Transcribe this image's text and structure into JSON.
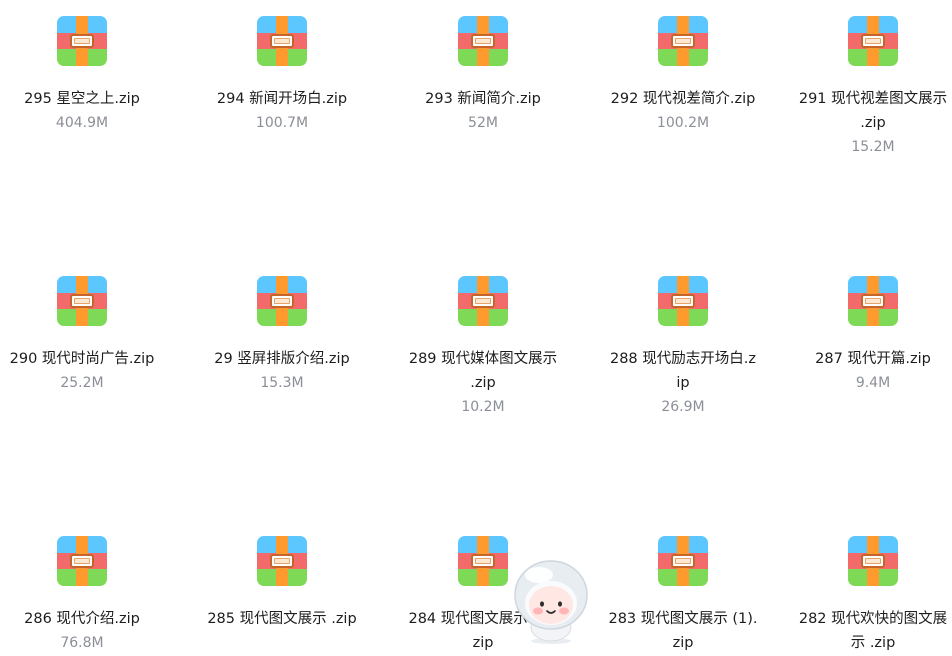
{
  "files": [
    {
      "name": "295 星空之上.zip",
      "size": "404.9M"
    },
    {
      "name": "294 新闻开场白.zip",
      "size": "100.7M"
    },
    {
      "name": "293 新闻简介.zip",
      "size": "52M"
    },
    {
      "name": "292 现代视差简介.zip",
      "size": "100.2M"
    },
    {
      "name": "291 现代视差图文展示 .zip",
      "size": "15.2M"
    },
    {
      "name": "290 现代时尚广告.zip",
      "size": "25.2M"
    },
    {
      "name": "29 竖屏排版介绍.zip",
      "size": "15.3M"
    },
    {
      "name": "289 现代媒体图文展示 .zip",
      "size": "10.2M"
    },
    {
      "name": "288 现代励志开场白.zip",
      "size": "26.9M"
    },
    {
      "name": "287 现代开篇.zip",
      "size": "9.4M"
    },
    {
      "name": "286 现代介绍.zip",
      "size": "76.8M"
    },
    {
      "name": "285 现代图文展示 .zip",
      "size": ""
    },
    {
      "name": "284 现代图文展示 (2).zip",
      "size": ""
    },
    {
      "name": "283 现代图文展示 (1).zip",
      "size": ""
    },
    {
      "name": "282 现代欢快的图文展示 .zip",
      "size": ""
    }
  ],
  "icons": {
    "file": "zip-archive-icon",
    "assistant": "assistant-mascot-icon"
  },
  "colors": {
    "text": "#1d1d1f",
    "meta": "#8b8f97",
    "background": "#ffffff"
  }
}
